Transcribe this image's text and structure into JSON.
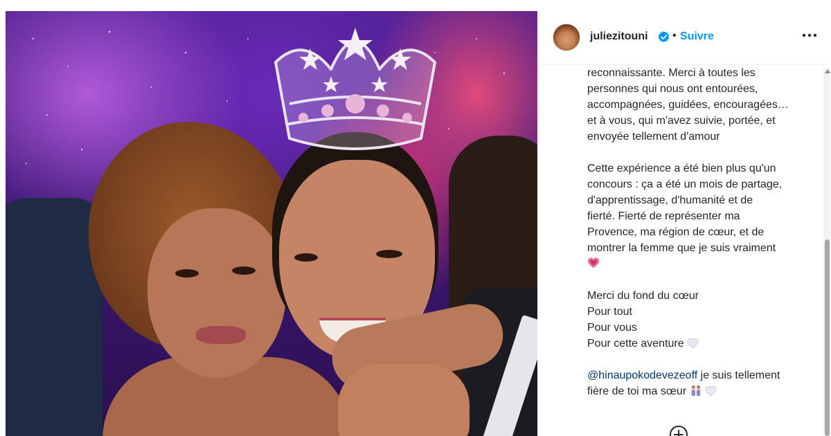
{
  "post": {
    "username": "juliezitouni",
    "separator": "•",
    "follow_label": "Suivre",
    "caption_lines": [
      "reconnaissante. Merci à toutes les",
      "personnes qui nous ont entourées,",
      "accompagnées, guidées, encouragées…",
      "et à vous, qui m'avez suivie, portée, et",
      "envoyée tellement d'amour"
    ],
    "caption_para2": [
      "Cette expérience a été bien plus qu'un",
      "concours : ça a été un mois de partage,",
      "d'apprentissage, d'humanité et de",
      "fierté. Fierté de représenter ma",
      "Provence, ma région de cœur, et de",
      "montrer la femme que je suis vraiment"
    ],
    "caption_para3": [
      "Merci du fond du cœur",
      "Pour tout",
      "Pour vous",
      "Pour cette aventure"
    ],
    "mention": "@hinaupokodevezeoff",
    "mention_tail": " je suis tellement",
    "last_line": "fière de toi ma sœur"
  },
  "icons": {
    "verified": "verified-badge-icon",
    "more": "more-options-icon",
    "heart_emoji": "growing-heart-emoji",
    "white_heart": "white-heart-emoji",
    "women": "two-women-emoji",
    "add": "add-comment-icon"
  },
  "colors": {
    "follow": "#0095f6",
    "verified": "#0095f6",
    "mention": "#00376b"
  }
}
